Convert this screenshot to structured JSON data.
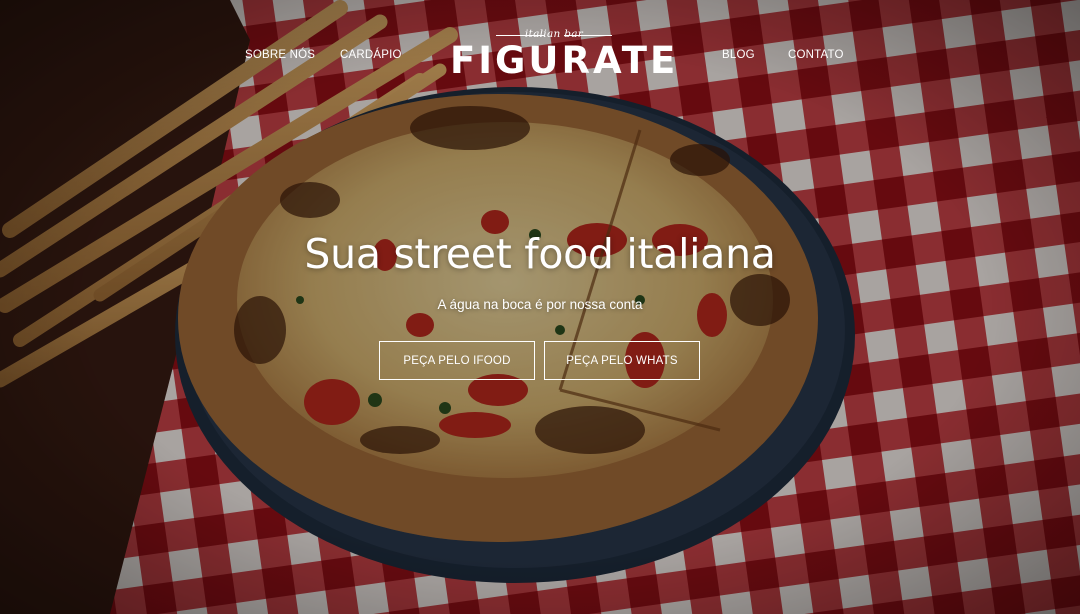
{
  "nav": {
    "left": [
      {
        "label": "SOBRE NÓS"
      },
      {
        "label": "CARDÁPIO"
      }
    ],
    "right": [
      {
        "label": "BLOG"
      },
      {
        "label": "CONTATO"
      }
    ]
  },
  "logo": {
    "tagline": "italian bar",
    "wordmark": "FIGURATE"
  },
  "hero": {
    "title": "Sua street food italiana",
    "subtitle": "A água na boca é por nossa conta",
    "buttons": [
      {
        "label": "PEÇA PELO IFOOD"
      },
      {
        "label": "PEÇA PELO WHATS"
      }
    ]
  },
  "colors": {
    "checker_red": "#b4171e",
    "checker_white": "#e9e2de",
    "plate": "#273548",
    "crust": "#b07a45",
    "cheese": "#dcc792",
    "tomato": "#b3271c",
    "board": "#4a2418",
    "breadstick": "#c79555"
  }
}
